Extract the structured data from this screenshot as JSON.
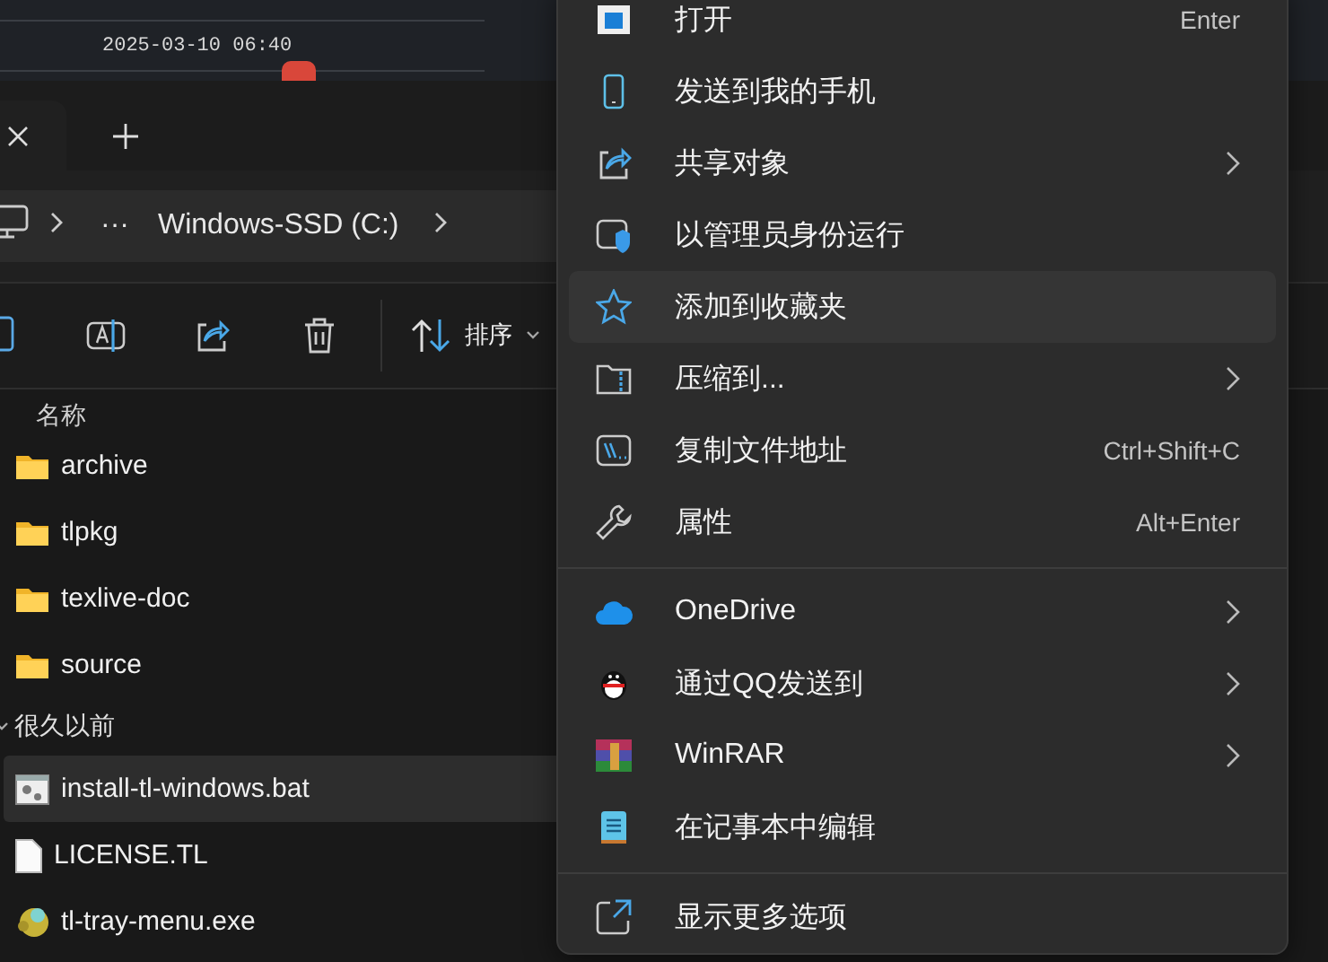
{
  "background_window": {
    "timestamp": "2025-03-10 06:40"
  },
  "explorer": {
    "address": {
      "overflow": "···",
      "crumbs": [
        "Windows-SSD (C:)"
      ]
    },
    "toolbar": {
      "sort_label": "排序"
    },
    "file_list": {
      "column": "名称",
      "rows": [
        {
          "kind": "folder",
          "name": "archive",
          "selected": false
        },
        {
          "kind": "folder",
          "name": "tlpkg",
          "selected": false
        },
        {
          "kind": "folder",
          "name": "texlive-doc",
          "selected": false
        },
        {
          "kind": "folder",
          "name": "source",
          "selected": false
        },
        {
          "kind": "group",
          "name": "很久以前",
          "expanded": true
        },
        {
          "kind": "script",
          "name": "install-tl-windows.bat",
          "selected": true
        },
        {
          "kind": "document",
          "name": "LICENSE.TL",
          "selected": false
        },
        {
          "kind": "app",
          "name": "tl-tray-menu.exe",
          "selected": false
        }
      ]
    }
  },
  "context_menu": {
    "items": [
      {
        "kind": "item",
        "label": "打开",
        "shortcut": "Enter",
        "submenu": false,
        "hovered": false
      },
      {
        "kind": "item",
        "label": "发送到我的手机",
        "submenu": false,
        "hovered": false
      },
      {
        "kind": "item",
        "label": "共享对象",
        "submenu": true,
        "hovered": false
      },
      {
        "kind": "item",
        "label": "以管理员身份运行",
        "submenu": false,
        "hovered": false
      },
      {
        "kind": "item",
        "label": "添加到收藏夹",
        "submenu": false,
        "hovered": true
      },
      {
        "kind": "item",
        "label": "压缩到...",
        "submenu": true,
        "hovered": false
      },
      {
        "kind": "item",
        "label": "复制文件地址",
        "shortcut": "Ctrl+Shift+C",
        "submenu": false,
        "hovered": false
      },
      {
        "kind": "item",
        "label": "属性",
        "shortcut": "Alt+Enter",
        "submenu": false,
        "hovered": false
      },
      {
        "kind": "separator"
      },
      {
        "kind": "item",
        "label": "OneDrive",
        "submenu": true,
        "hovered": false
      },
      {
        "kind": "item",
        "label": "通过QQ发送到",
        "submenu": true,
        "hovered": false
      },
      {
        "kind": "item",
        "label": "WinRAR",
        "submenu": true,
        "hovered": false
      },
      {
        "kind": "item",
        "label": "在记事本中编辑",
        "submenu": false,
        "hovered": false
      },
      {
        "kind": "separator"
      },
      {
        "kind": "item",
        "label": "显示更多选项",
        "submenu": false,
        "hovered": false
      }
    ]
  }
}
